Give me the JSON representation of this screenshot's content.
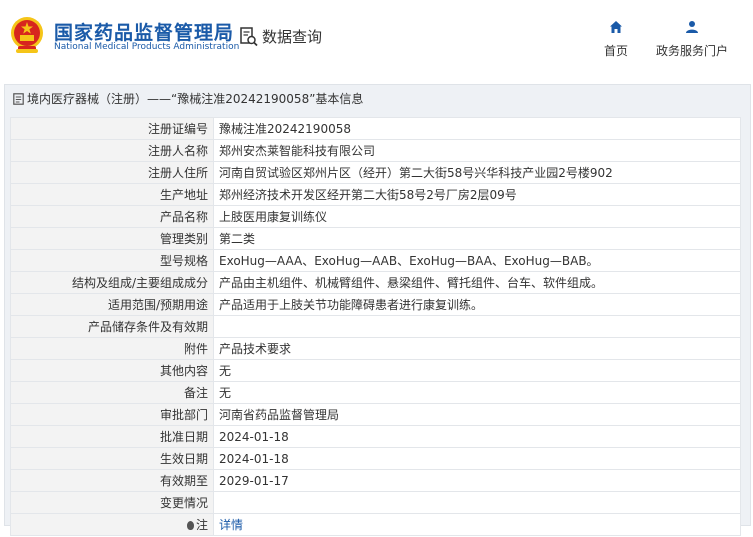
{
  "header": {
    "logo_cn": "国家药品监督管理局",
    "logo_en": "National Medical Products Administration",
    "query_label": "数据查询",
    "nav": [
      {
        "label": "首页",
        "icon": "home-icon"
      },
      {
        "label": "政务服务门户",
        "icon": "user-icon"
      }
    ]
  },
  "panel": {
    "title": "境内医疗器械（注册）——“豫械注准20242190058”基本信息"
  },
  "rows": [
    {
      "label": "注册证编号",
      "value": "豫械注准20242190058"
    },
    {
      "label": "注册人名称",
      "value": "郑州安杰莱智能科技有限公司"
    },
    {
      "label": "注册人住所",
      "value": "河南自贸试验区郑州片区（经开）第二大街58号兴华科技产业园2号楼902"
    },
    {
      "label": "生产地址",
      "value": "郑州经济技术开发区经开第二大街58号2号厂房2层09号"
    },
    {
      "label": "产品名称",
      "value": "上肢医用康复训练仪"
    },
    {
      "label": "管理类别",
      "value": "第二类"
    },
    {
      "label": "型号规格",
      "value": "ExoHug—AAA、ExoHug—AAB、ExoHug—BAA、ExoHug—BAB。"
    },
    {
      "label": "结构及组成/主要组成成分",
      "value": "产品由主机组件、机械臂组件、悬梁组件、臂托组件、台车、软件组成。"
    },
    {
      "label": "适用范围/预期用途",
      "value": "产品适用于上肢关节功能障碍患者进行康复训练。"
    },
    {
      "label": "产品储存条件及有效期",
      "value": ""
    },
    {
      "label": "附件",
      "value": "产品技术要求"
    },
    {
      "label": "其他内容",
      "value": "无"
    },
    {
      "label": "备注",
      "value": "无"
    },
    {
      "label": "审批部门",
      "value": "河南省药品监督管理局"
    },
    {
      "label": "批准日期",
      "value": "2024-01-18"
    },
    {
      "label": "生效日期",
      "value": "2024-01-18"
    },
    {
      "label": "有效期至",
      "value": "2029-01-17"
    },
    {
      "label": "变更情况",
      "value": ""
    }
  ],
  "note": {
    "label": "注",
    "link": "详情"
  },
  "colors": {
    "brand": "#1a5aa8",
    "label_bg": "#f3f3f3",
    "panel_bg": "#eef1f5",
    "emblem_red": "#d7261e",
    "emblem_gold": "#f5c518"
  }
}
